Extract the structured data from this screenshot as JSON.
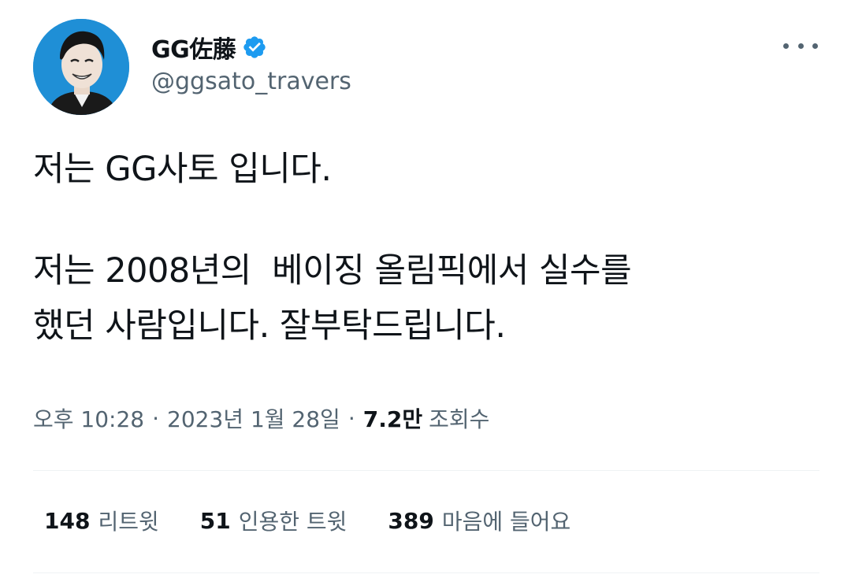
{
  "author": {
    "display_name": "GG佐藤",
    "handle": "@ggsato_travers",
    "verified": true
  },
  "tweet": {
    "paragraphs": [
      "저는 GG사토 입니다.",
      "저는 2008년의  베이징 올림픽에서 실수를\n했던 사람입니다. 잘부탁드립니다."
    ]
  },
  "meta": {
    "time": "오후 10:28",
    "separator": "·",
    "date": "2023년 1월 28일",
    "views_count": "7.2만",
    "views_label": "조회수"
  },
  "stats": [
    {
      "count": "148",
      "label": "리트윗"
    },
    {
      "count": "51",
      "label": "인용한 트윗"
    },
    {
      "count": "389",
      "label": "마음에 들어요"
    }
  ],
  "colors": {
    "text_primary": "#0f1419",
    "text_secondary": "#536471",
    "verified_blue": "#1d9bf0",
    "avatar_bg": "#1f8fd6",
    "divider": "#eff3f4"
  },
  "icons": {
    "verified": "verified-badge-icon",
    "more": "more-options-icon"
  }
}
